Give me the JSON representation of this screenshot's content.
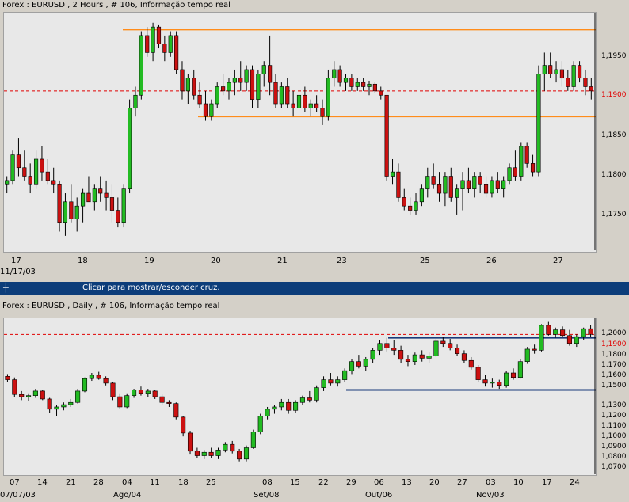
{
  "top_chart": {
    "title": "Forex : EURUSD , 2 Hours , # 106, Informação tempo real",
    "current_price_label": "1,1900",
    "y_tick_labels": [
      "1,1950",
      "1,1900",
      "1,1850",
      "1,1800",
      "1,1750"
    ],
    "x_tick_labels": [
      "17",
      "18",
      "19",
      "20",
      "21",
      "23",
      "25",
      "26",
      "27"
    ],
    "x_sub_label": "11/17/03",
    "colors": {
      "up": "#22bb22",
      "down": "#cc1111",
      "resistance": "#ff8c1a",
      "price_line": "#e00000"
    }
  },
  "status_bar": {
    "cross_icon": "crosshair-icon",
    "message": "Clicar para mostrar/esconder cruz."
  },
  "bottom_chart": {
    "title": "Forex : EURUSD , Daily , # 106, Informação tempo real",
    "current_price_label": "1,1900",
    "y_tick_labels": [
      "1,2000",
      "1,1800",
      "1,1700",
      "1,1600",
      "1,1500",
      "1,1300",
      "1,1200",
      "1,1100",
      "1,1000",
      "1,0900",
      "1,0800",
      "1,0700"
    ],
    "x_tick_labels": [
      "07",
      "14",
      "21",
      "28",
      "04",
      "11",
      "18",
      "25",
      "08",
      "15",
      "22",
      "29",
      "06",
      "13",
      "20",
      "27",
      "03",
      "10",
      "17",
      "24"
    ],
    "x_sub_labels": [
      "07/07/03",
      "Ago/04",
      "Set/08",
      "Out/06",
      "Nov/03"
    ],
    "colors": {
      "up": "#22bb22",
      "down": "#cc1111",
      "channel": "#1a3a7a",
      "price_line": "#e00000"
    }
  },
  "chart_data": [
    {
      "type": "candlestick",
      "title": "Forex : EURUSD , 2 Hours , # 106, Informação tempo real",
      "ylim": [
        1.1715,
        1.199
      ],
      "x_ticks": [
        "17",
        "18",
        "19",
        "20",
        "21",
        "23",
        "25",
        "26",
        "27"
      ],
      "reference_lines": [
        {
          "kind": "horizontal",
          "value": 1.1972,
          "color": "#ff8c1a"
        },
        {
          "kind": "horizontal",
          "value": 1.187,
          "color": "#ff8c1a"
        },
        {
          "kind": "horizontal",
          "value": 1.19,
          "color": "#e00000",
          "style": "dashed"
        }
      ],
      "candles": [
        [
          1.179,
          1.18,
          1.178,
          1.1795
        ],
        [
          1.1795,
          1.183,
          1.179,
          1.1825
        ],
        [
          1.1825,
          1.1845,
          1.18,
          1.181
        ],
        [
          1.181,
          1.183,
          1.1795,
          1.18
        ],
        [
          1.18,
          1.1815,
          1.178,
          1.179
        ],
        [
          1.179,
          1.183,
          1.1785,
          1.182
        ],
        [
          1.182,
          1.1835,
          1.1795,
          1.1805
        ],
        [
          1.1805,
          1.182,
          1.179,
          1.1795
        ],
        [
          1.1795,
          1.181,
          1.178,
          1.179
        ],
        [
          1.179,
          1.1795,
          1.1735,
          1.1745
        ],
        [
          1.1745,
          1.178,
          1.173,
          1.177
        ],
        [
          1.177,
          1.179,
          1.1745,
          1.175
        ],
        [
          1.175,
          1.1775,
          1.1735,
          1.1765
        ],
        [
          1.1765,
          1.1785,
          1.1745,
          1.178
        ],
        [
          1.178,
          1.18,
          1.177,
          1.177
        ],
        [
          1.177,
          1.179,
          1.176,
          1.1785
        ],
        [
          1.1785,
          1.18,
          1.177,
          1.178
        ],
        [
          1.178,
          1.1795,
          1.176,
          1.1775
        ],
        [
          1.1775,
          1.179,
          1.1745,
          1.176
        ],
        [
          1.176,
          1.1775,
          1.174,
          1.1745
        ],
        [
          1.1745,
          1.179,
          1.174,
          1.1785
        ],
        [
          1.1785,
          1.189,
          1.178,
          1.188
        ],
        [
          1.188,
          1.1905,
          1.187,
          1.1895
        ],
        [
          1.1895,
          1.197,
          1.189,
          1.1965
        ],
        [
          1.1965,
          1.1975,
          1.194,
          1.1945
        ],
        [
          1.1945,
          1.198,
          1.1935,
          1.1975
        ],
        [
          1.1975,
          1.1978,
          1.195,
          1.1955
        ],
        [
          1.1955,
          1.1965,
          1.1935,
          1.1945
        ],
        [
          1.1945,
          1.197,
          1.194,
          1.1965
        ],
        [
          1.1965,
          1.197,
          1.192,
          1.1925
        ],
        [
          1.1925,
          1.1935,
          1.189,
          1.19
        ],
        [
          1.19,
          1.192,
          1.1885,
          1.1915
        ],
        [
          1.1915,
          1.1925,
          1.189,
          1.1895
        ],
        [
          1.1895,
          1.191,
          1.188,
          1.1885
        ],
        [
          1.1885,
          1.19,
          1.1865,
          1.187
        ],
        [
          1.187,
          1.189,
          1.1865,
          1.1885
        ],
        [
          1.1885,
          1.191,
          1.188,
          1.1905
        ],
        [
          1.1905,
          1.192,
          1.1895,
          1.19
        ],
        [
          1.19,
          1.1915,
          1.189,
          1.191
        ],
        [
          1.191,
          1.1925,
          1.1895,
          1.1915
        ],
        [
          1.1915,
          1.1935,
          1.19,
          1.191
        ],
        [
          1.191,
          1.193,
          1.19,
          1.1925
        ],
        [
          1.1925,
          1.193,
          1.188,
          1.189
        ],
        [
          1.189,
          1.1925,
          1.188,
          1.192
        ],
        [
          1.192,
          1.1935,
          1.1905,
          1.193
        ],
        [
          1.193,
          1.1965,
          1.1895,
          1.191
        ],
        [
          1.191,
          1.192,
          1.188,
          1.1885
        ],
        [
          1.1885,
          1.191,
          1.188,
          1.1905
        ],
        [
          1.1905,
          1.1915,
          1.188,
          1.1885
        ],
        [
          1.1885,
          1.19,
          1.187,
          1.188
        ],
        [
          1.188,
          1.19,
          1.1875,
          1.1895
        ],
        [
          1.1895,
          1.1905,
          1.1875,
          1.188
        ],
        [
          1.188,
          1.189,
          1.187,
          1.1885
        ],
        [
          1.1885,
          1.1895,
          1.1875,
          1.188
        ],
        [
          1.188,
          1.189,
          1.186,
          1.187
        ],
        [
          1.187,
          1.1925,
          1.1865,
          1.1915
        ],
        [
          1.1915,
          1.1935,
          1.1905,
          1.1925
        ],
        [
          1.1925,
          1.193,
          1.1905,
          1.191
        ],
        [
          1.191,
          1.192,
          1.19,
          1.1915
        ],
        [
          1.1915,
          1.192,
          1.19,
          1.1905
        ],
        [
          1.1905,
          1.1915,
          1.19,
          1.191
        ],
        [
          1.191,
          1.1915,
          1.19,
          1.1905
        ],
        [
          1.1905,
          1.1912,
          1.1895,
          1.1908
        ],
        [
          1.1908,
          1.191,
          1.1898,
          1.19
        ],
        [
          1.19,
          1.1905,
          1.189,
          1.1895
        ],
        [
          1.1895,
          1.1895,
          1.1795,
          1.18
        ],
        [
          1.18,
          1.182,
          1.179,
          1.1805
        ],
        [
          1.1805,
          1.1815,
          1.177,
          1.1775
        ],
        [
          1.1775,
          1.1785,
          1.176,
          1.1765
        ],
        [
          1.1765,
          1.1775,
          1.1755,
          1.176
        ],
        [
          1.176,
          1.178,
          1.1755,
          1.177
        ],
        [
          1.177,
          1.179,
          1.1765,
          1.1785
        ],
        [
          1.1785,
          1.181,
          1.1775,
          1.18
        ],
        [
          1.18,
          1.1815,
          1.1785,
          1.179
        ],
        [
          1.179,
          1.1805,
          1.177,
          1.178
        ],
        [
          1.178,
          1.1805,
          1.1765,
          1.18
        ],
        [
          1.18,
          1.181,
          1.177,
          1.1775
        ],
        [
          1.1775,
          1.179,
          1.1755,
          1.1785
        ],
        [
          1.1785,
          1.1805,
          1.176,
          1.1795
        ],
        [
          1.1795,
          1.181,
          1.178,
          1.1785
        ],
        [
          1.1785,
          1.1805,
          1.1775,
          1.18
        ],
        [
          1.18,
          1.1805,
          1.178,
          1.179
        ],
        [
          1.179,
          1.18,
          1.1775,
          1.178
        ],
        [
          1.178,
          1.18,
          1.1775,
          1.1795
        ],
        [
          1.1795,
          1.1805,
          1.178,
          1.1785
        ],
        [
          1.1785,
          1.18,
          1.1775,
          1.1795
        ],
        [
          1.1795,
          1.1815,
          1.179,
          1.181
        ],
        [
          1.181,
          1.183,
          1.1795,
          1.18
        ],
        [
          1.18,
          1.184,
          1.1795,
          1.1835
        ],
        [
          1.1835,
          1.184,
          1.181,
          1.1815
        ],
        [
          1.1815,
          1.1825,
          1.18,
          1.1805
        ],
        [
          1.1805,
          1.193,
          1.18,
          1.192
        ],
        [
          1.192,
          1.1945,
          1.19,
          1.193
        ],
        [
          1.193,
          1.1945,
          1.1915,
          1.192
        ],
        [
          1.192,
          1.1935,
          1.191,
          1.1925
        ],
        [
          1.1925,
          1.1935,
          1.1905,
          1.1915
        ],
        [
          1.1915,
          1.1925,
          1.19,
          1.1905
        ],
        [
          1.1905,
          1.1935,
          1.19,
          1.193
        ],
        [
          1.193,
          1.1935,
          1.191,
          1.1915
        ],
        [
          1.1915,
          1.1925,
          1.1895,
          1.1905
        ],
        [
          1.1905,
          1.1915,
          1.189,
          1.19
        ]
      ]
    },
    {
      "type": "candlestick",
      "title": "Forex : EURUSD , Daily , # 106, Informação tempo real",
      "ylim": [
        1.068,
        1.2035
      ],
      "x_ticks": [
        "07",
        "14",
        "21",
        "28",
        "04",
        "11",
        "18",
        "25",
        "08",
        "15",
        "22",
        "29",
        "06",
        "13",
        "20",
        "27",
        "03",
        "10",
        "17",
        "24"
      ],
      "reference_lines": [
        {
          "kind": "horizontal",
          "value": 1.187,
          "color": "#1a3a7a"
        },
        {
          "kind": "horizontal",
          "value": 1.141,
          "color": "#1a3a7a"
        },
        {
          "kind": "horizontal",
          "value": 1.19,
          "color": "#e00000",
          "style": "dashed"
        }
      ],
      "candles": [
        [
          1.153,
          1.155,
          1.148,
          1.15
        ],
        [
          1.15,
          1.152,
          1.135,
          1.137
        ],
        [
          1.137,
          1.14,
          1.132,
          1.135
        ],
        [
          1.135,
          1.138,
          1.131,
          1.136
        ],
        [
          1.136,
          1.142,
          1.134,
          1.14
        ],
        [
          1.14,
          1.141,
          1.132,
          1.133
        ],
        [
          1.133,
          1.134,
          1.121,
          1.124
        ],
        [
          1.124,
          1.128,
          1.118,
          1.126
        ],
        [
          1.126,
          1.13,
          1.123,
          1.128
        ],
        [
          1.128,
          1.133,
          1.126,
          1.13
        ],
        [
          1.13,
          1.142,
          1.129,
          1.14
        ],
        [
          1.14,
          1.152,
          1.139,
          1.151
        ],
        [
          1.151,
          1.156,
          1.149,
          1.154
        ],
        [
          1.154,
          1.157,
          1.15,
          1.151
        ],
        [
          1.151,
          1.153,
          1.145,
          1.147
        ],
        [
          1.147,
          1.148,
          1.132,
          1.135
        ],
        [
          1.135,
          1.138,
          1.124,
          1.126
        ],
        [
          1.126,
          1.138,
          1.125,
          1.136
        ],
        [
          1.136,
          1.142,
          1.134,
          1.141
        ],
        [
          1.141,
          1.144,
          1.136,
          1.138
        ],
        [
          1.138,
          1.142,
          1.135,
          1.14
        ],
        [
          1.14,
          1.141,
          1.133,
          1.135
        ],
        [
          1.135,
          1.137,
          1.128,
          1.13
        ],
        [
          1.13,
          1.132,
          1.126,
          1.129
        ],
        [
          1.129,
          1.13,
          1.115,
          1.117
        ],
        [
          1.117,
          1.118,
          1.1,
          1.103
        ],
        [
          1.103,
          1.105,
          1.084,
          1.087
        ],
        [
          1.087,
          1.09,
          1.081,
          1.083
        ],
        [
          1.083,
          1.088,
          1.08,
          1.086
        ],
        [
          1.086,
          1.09,
          1.081,
          1.083
        ],
        [
          1.083,
          1.09,
          1.08,
          1.088
        ],
        [
          1.088,
          1.095,
          1.086,
          1.093
        ],
        [
          1.093,
          1.096,
          1.085,
          1.087
        ],
        [
          1.087,
          1.089,
          1.078,
          1.08
        ],
        [
          1.08,
          1.092,
          1.078,
          1.09
        ],
        [
          1.09,
          1.106,
          1.089,
          1.104
        ],
        [
          1.104,
          1.12,
          1.102,
          1.118
        ],
        [
          1.118,
          1.126,
          1.115,
          1.124
        ],
        [
          1.124,
          1.128,
          1.12,
          1.126
        ],
        [
          1.126,
          1.133,
          1.123,
          1.13
        ],
        [
          1.13,
          1.133,
          1.12,
          1.123
        ],
        [
          1.123,
          1.132,
          1.121,
          1.13
        ],
        [
          1.13,
          1.136,
          1.128,
          1.134
        ],
        [
          1.134,
          1.14,
          1.13,
          1.132
        ],
        [
          1.132,
          1.145,
          1.13,
          1.143
        ],
        [
          1.143,
          1.153,
          1.14,
          1.15
        ],
        [
          1.15,
          1.156,
          1.145,
          1.147
        ],
        [
          1.147,
          1.153,
          1.144,
          1.15
        ],
        [
          1.15,
          1.16,
          1.148,
          1.158
        ],
        [
          1.158,
          1.168,
          1.155,
          1.166
        ],
        [
          1.166,
          1.172,
          1.16,
          1.162
        ],
        [
          1.162,
          1.17,
          1.158,
          1.168
        ],
        [
          1.168,
          1.178,
          1.165,
          1.176
        ],
        [
          1.176,
          1.185,
          1.172,
          1.182
        ],
        [
          1.182,
          1.187,
          1.175,
          1.178
        ],
        [
          1.178,
          1.185,
          1.172,
          1.176
        ],
        [
          1.176,
          1.18,
          1.165,
          1.168
        ],
        [
          1.168,
          1.172,
          1.162,
          1.166
        ],
        [
          1.166,
          1.174,
          1.163,
          1.172
        ],
        [
          1.172,
          1.176,
          1.166,
          1.169
        ],
        [
          1.169,
          1.174,
          1.165,
          1.171
        ],
        [
          1.171,
          1.186,
          1.17,
          1.184
        ],
        [
          1.184,
          1.188,
          1.179,
          1.182
        ],
        [
          1.182,
          1.186,
          1.176,
          1.178
        ],
        [
          1.178,
          1.181,
          1.171,
          1.173
        ],
        [
          1.173,
          1.176,
          1.165,
          1.167
        ],
        [
          1.167,
          1.17,
          1.159,
          1.161
        ],
        [
          1.161,
          1.163,
          1.148,
          1.15
        ],
        [
          1.15,
          1.154,
          1.144,
          1.147
        ],
        [
          1.147,
          1.151,
          1.143,
          1.148
        ],
        [
          1.148,
          1.15,
          1.142,
          1.145
        ],
        [
          1.145,
          1.158,
          1.143,
          1.156
        ],
        [
          1.156,
          1.16,
          1.15,
          1.152
        ],
        [
          1.152,
          1.168,
          1.151,
          1.166
        ],
        [
          1.166,
          1.179,
          1.164,
          1.177
        ],
        [
          1.177,
          1.181,
          1.173,
          1.176
        ],
        [
          1.176,
          1.199,
          1.175,
          1.198
        ],
        [
          1.198,
          1.201,
          1.189,
          1.19
        ],
        [
          1.19,
          1.196,
          1.187,
          1.194
        ],
        [
          1.194,
          1.197,
          1.188,
          1.189
        ],
        [
          1.189,
          1.194,
          1.18,
          1.182
        ],
        [
          1.182,
          1.19,
          1.179,
          1.188
        ],
        [
          1.188,
          1.196,
          1.185,
          1.195
        ],
        [
          1.195,
          1.198,
          1.188,
          1.19
        ]
      ]
    }
  ]
}
